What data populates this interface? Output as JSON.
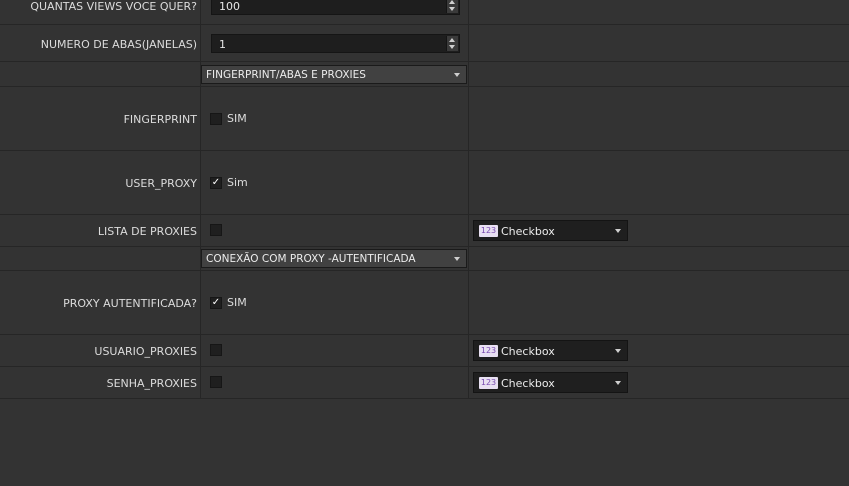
{
  "rows": {
    "views": {
      "label": "QUANTAS VIEWS VOCE QUER?",
      "value": "100"
    },
    "abas": {
      "label": "NUMERO DE ABAS(JANELAS)",
      "value": "1"
    },
    "section1": {
      "value": "FINGERPRINT/ABAS E PROXIES"
    },
    "fingerprint": {
      "label": "FINGERPRINT",
      "checkbox_text": "SIM",
      "checked": false
    },
    "user_proxy": {
      "label": "USER_PROXY",
      "checkbox_text": "Sim",
      "checked": true
    },
    "lista_proxies": {
      "label": "LISTA DE PROXIES",
      "checked": false,
      "type_badge": "123",
      "type_value": "Checkbox"
    },
    "section2": {
      "value": "CONEXÃO COM PROXY -AUTENTIFICADA"
    },
    "proxy_auth": {
      "label": "PROXY AUTENTIFICADA?",
      "checkbox_text": "SIM",
      "checked": true
    },
    "usuario_proxies": {
      "label": "USUARIO_PROXIES",
      "checked": false,
      "type_badge": "123",
      "type_value": "Checkbox"
    },
    "senha_proxies": {
      "label": "SENHA_PROXIES",
      "checked": false,
      "type_badge": "123",
      "type_value": "Checkbox"
    }
  },
  "icons": {
    "check": "✓"
  }
}
